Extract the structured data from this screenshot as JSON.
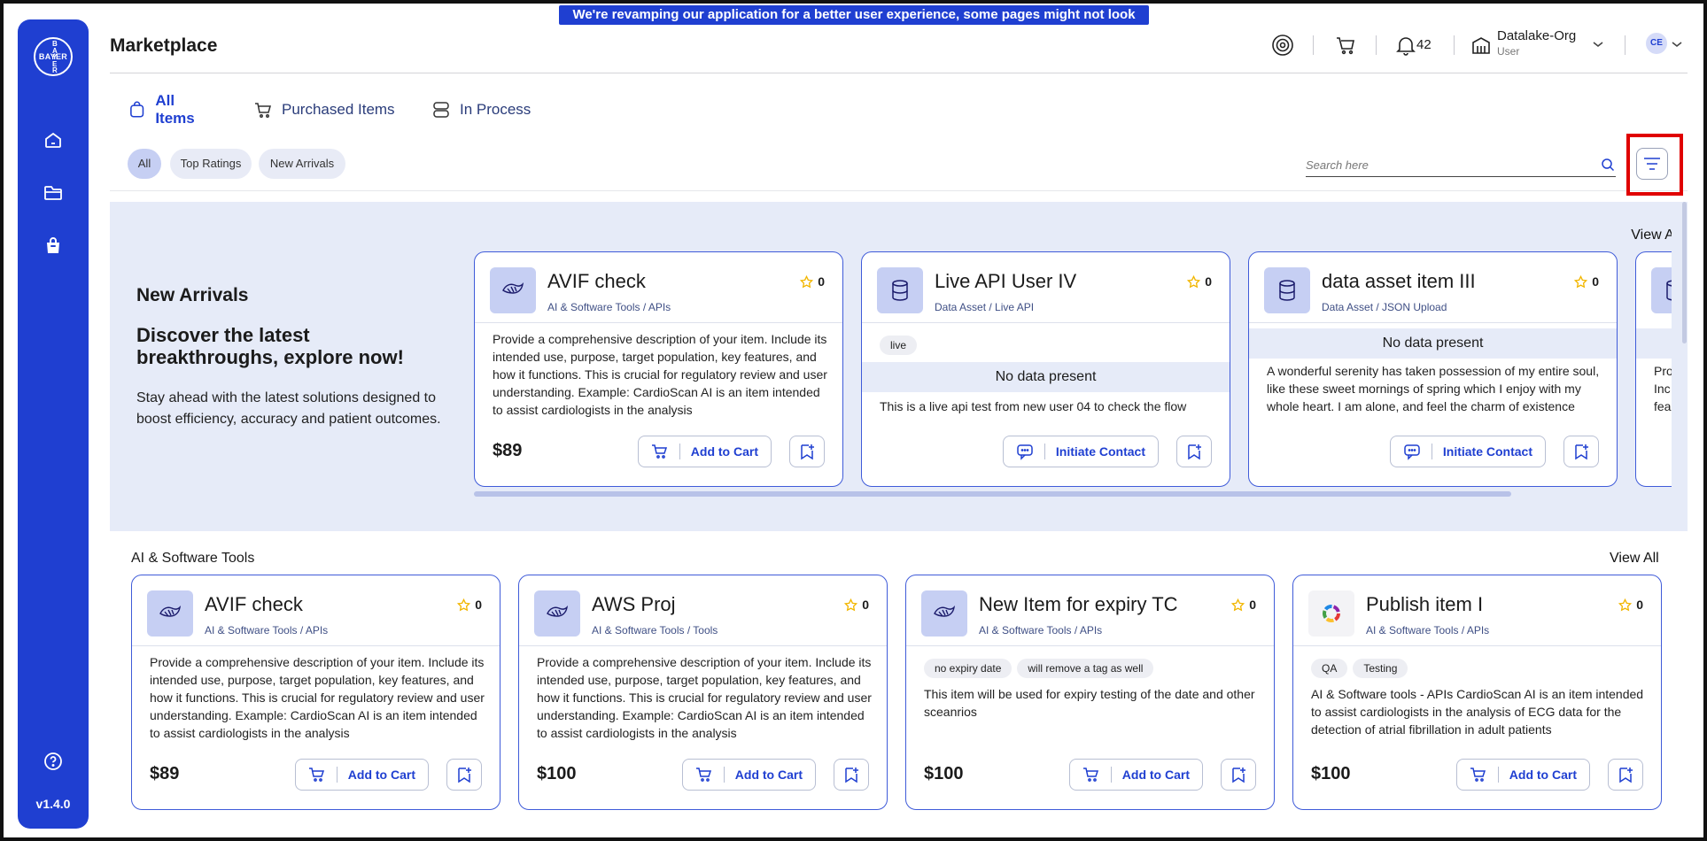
{
  "banner": "We're revamping our application for a better user experience, some pages might not look perfect yet!",
  "sidebar": {
    "logo_text": "BAYER",
    "version": "v1.4.0"
  },
  "header": {
    "title": "Marketplace",
    "notifications_count": "42",
    "org_name": "Datalake-Org",
    "org_role": "User",
    "avatar_initials": "CE"
  },
  "tabs": [
    {
      "label": "All Items"
    },
    {
      "label": "Purchased Items"
    },
    {
      "label": "In Process"
    }
  ],
  "filters": {
    "chips": [
      "All",
      "Top Ratings",
      "New Arrivals"
    ],
    "search_placeholder": "Search here"
  },
  "new_arrivals": {
    "title": "New Arrivals",
    "headline": "Discover the latest breakthroughs, explore now!",
    "description": "Stay ahead with the latest solutions designed to boost efficiency, accuracy and patient outcomes.",
    "view_all": "View All",
    "cards": [
      {
        "title": "AVIF check",
        "subtitle": "AI & Software Tools / APIs",
        "rating": "0",
        "price": "$89",
        "action": "Add to Cart",
        "description": "Provide a comprehensive description of your item. Include its intended use, purpose, target population, key features, and how it functions. This is crucial for regulatory review and user understanding. Example: CardioScan AI is an item intended to assist cardiologists in the analysis"
      },
      {
        "title": "Live API User IV",
        "subtitle": "Data Asset / Live API",
        "rating": "0",
        "tag": "live",
        "no_data": "No data present",
        "action": "Initiate Contact",
        "description": "This is a live api test from new user 04 to check the flow"
      },
      {
        "title": "data asset item III",
        "subtitle": "Data Asset / JSON Upload",
        "rating": "0",
        "no_data": "No data present",
        "action": "Initiate Contact",
        "description": "A wonderful serenity has taken possession of my entire soul, like these sweet mornings of spring which I enjoy with my whole heart. I am alone, and feel the charm of existence"
      }
    ],
    "peek_lines": [
      "Pro",
      "Inc",
      "fea"
    ]
  },
  "ai_tools": {
    "title": "AI & Software Tools",
    "view_all": "View All",
    "cards": [
      {
        "title": "AVIF check",
        "subtitle": "AI & Software Tools / APIs",
        "rating": "0",
        "price": "$89",
        "action": "Add to Cart",
        "description": "Provide a comprehensive description of your item. Include its intended use, purpose, target population, key features, and how it functions. This is crucial for regulatory review and user understanding. Example: CardioScan AI is an item intended to assist cardiologists in the analysis"
      },
      {
        "title": "AWS Proj",
        "subtitle": "AI & Software Tools / Tools",
        "rating": "0",
        "price": "$100",
        "action": "Add to Cart",
        "description": "Provide a comprehensive description of your item. Include its intended use, purpose, target population, key features, and how it functions. This is crucial for regulatory review and user understanding. Example: CardioScan AI is an item intended to assist cardiologists in the analysis"
      },
      {
        "title": "New Item for expiry TC",
        "subtitle": "AI & Software Tools / APIs",
        "rating": "0",
        "price": "$100",
        "action": "Add to Cart",
        "tags": [
          "no expiry date",
          "will remove a tag as well"
        ],
        "description": "This item will be used for expiry testing of the date and other sceanrios"
      },
      {
        "title": "Publish item I",
        "subtitle": "AI & Software Tools / APIs",
        "rating": "0",
        "price": "$100",
        "action": "Add to Cart",
        "tags": [
          "QA",
          "Testing"
        ],
        "description": "AI & Software tools - APIs CardioScan AI is an item intended to assist cardiologists in the analysis of ECG data for the detection of atrial fibrillation in adult patients"
      }
    ]
  },
  "colors": {
    "accent": "#1f3fd1",
    "card_border": "#3f5bd9",
    "section_bg": "#e6ebf8",
    "star": "#f2b600",
    "highlight": "#e00000"
  }
}
